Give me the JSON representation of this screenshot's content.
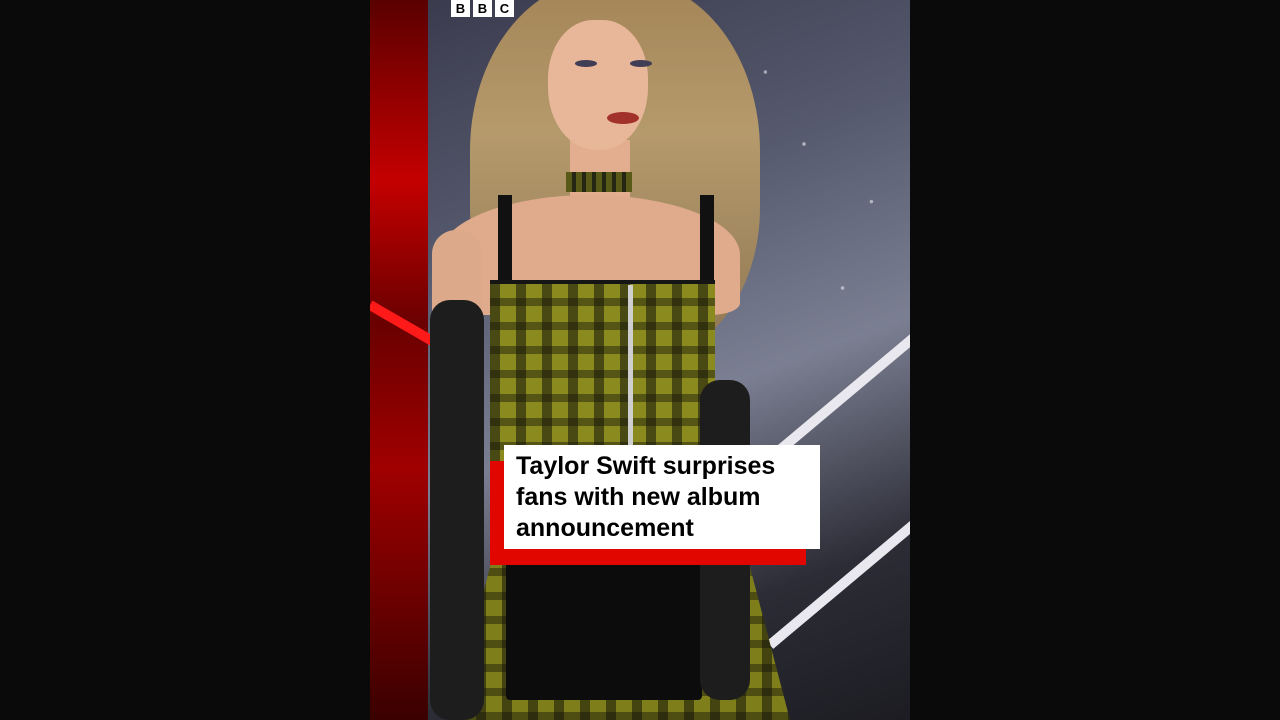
{
  "video": {
    "logo": {
      "letters": [
        "B",
        "B",
        "C"
      ]
    },
    "caption": {
      "text": "Taylor Swift surprises fans with new album announcement"
    },
    "colors": {
      "accent_red": "#e10600",
      "caption_bg": "#ffffff",
      "letterbox": "#0a0a0a"
    }
  }
}
